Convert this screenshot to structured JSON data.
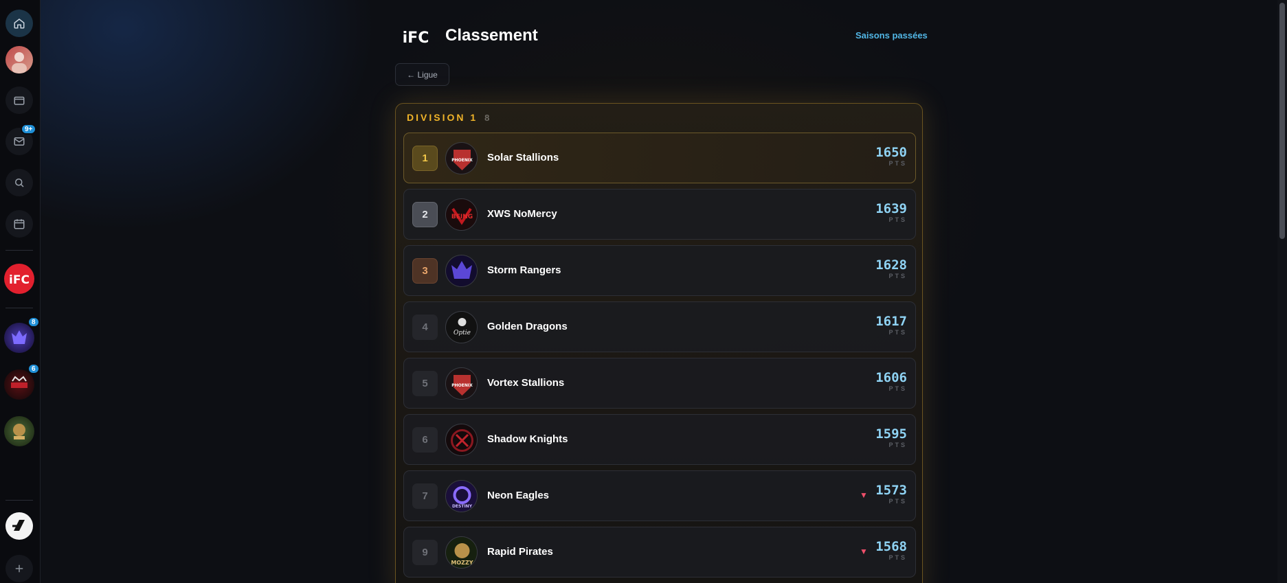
{
  "page": {
    "title": "Classement",
    "past_seasons_link": "Saisons passées",
    "back_button": "← Ligue"
  },
  "sidebar": {
    "nav_icons": [
      "home-icon",
      "user-avatar",
      "wallet-icon",
      "mail-icon",
      "search-icon",
      "calendar-icon"
    ],
    "mail_badge": "9+",
    "servers": [
      {
        "name": "ifc-server",
        "badge": ""
      },
      {
        "name": "nexo-server",
        "badge": "8"
      },
      {
        "name": "shadow-server",
        "badge": "6"
      },
      {
        "name": "mozzy-server",
        "badge": ""
      }
    ],
    "bottom_icons": [
      "brand-icon",
      "plus-icon"
    ]
  },
  "division": {
    "title": "DIVISION 1",
    "count": "8",
    "pts_label": "PTS",
    "teams": [
      {
        "rank": "1",
        "name": "Solar Stallions",
        "points": "1650",
        "trend": "",
        "logo_color": "#b8312f"
      },
      {
        "rank": "2",
        "name": "XWS NoMercy",
        "points": "1639",
        "trend": "",
        "logo_color": "#8a1515"
      },
      {
        "rank": "3",
        "name": "Storm Rangers",
        "points": "1628",
        "trend": "",
        "logo_color": "#3a2c8a"
      },
      {
        "rank": "4",
        "name": "Golden Dragons",
        "points": "1617",
        "trend": "",
        "logo_color": "#1e1e22"
      },
      {
        "rank": "5",
        "name": "Vortex Stallions",
        "points": "1606",
        "trend": "",
        "logo_color": "#b8312f"
      },
      {
        "rank": "6",
        "name": "Shadow Knights",
        "points": "1595",
        "trend": "",
        "logo_color": "#7a1218"
      },
      {
        "rank": "7",
        "name": "Neon Eagles",
        "points": "1573",
        "trend": "▼",
        "logo_color": "#5a3ac0"
      },
      {
        "rank": "9",
        "name": "Rapid Pirates",
        "points": "1568",
        "trend": "▼",
        "logo_color": "#3f5a2a"
      }
    ]
  },
  "colors": {
    "accent": "#f0b429",
    "points": "#8fd3f4",
    "link": "#52b7e6",
    "trend_down": "#ef4f6a"
  }
}
